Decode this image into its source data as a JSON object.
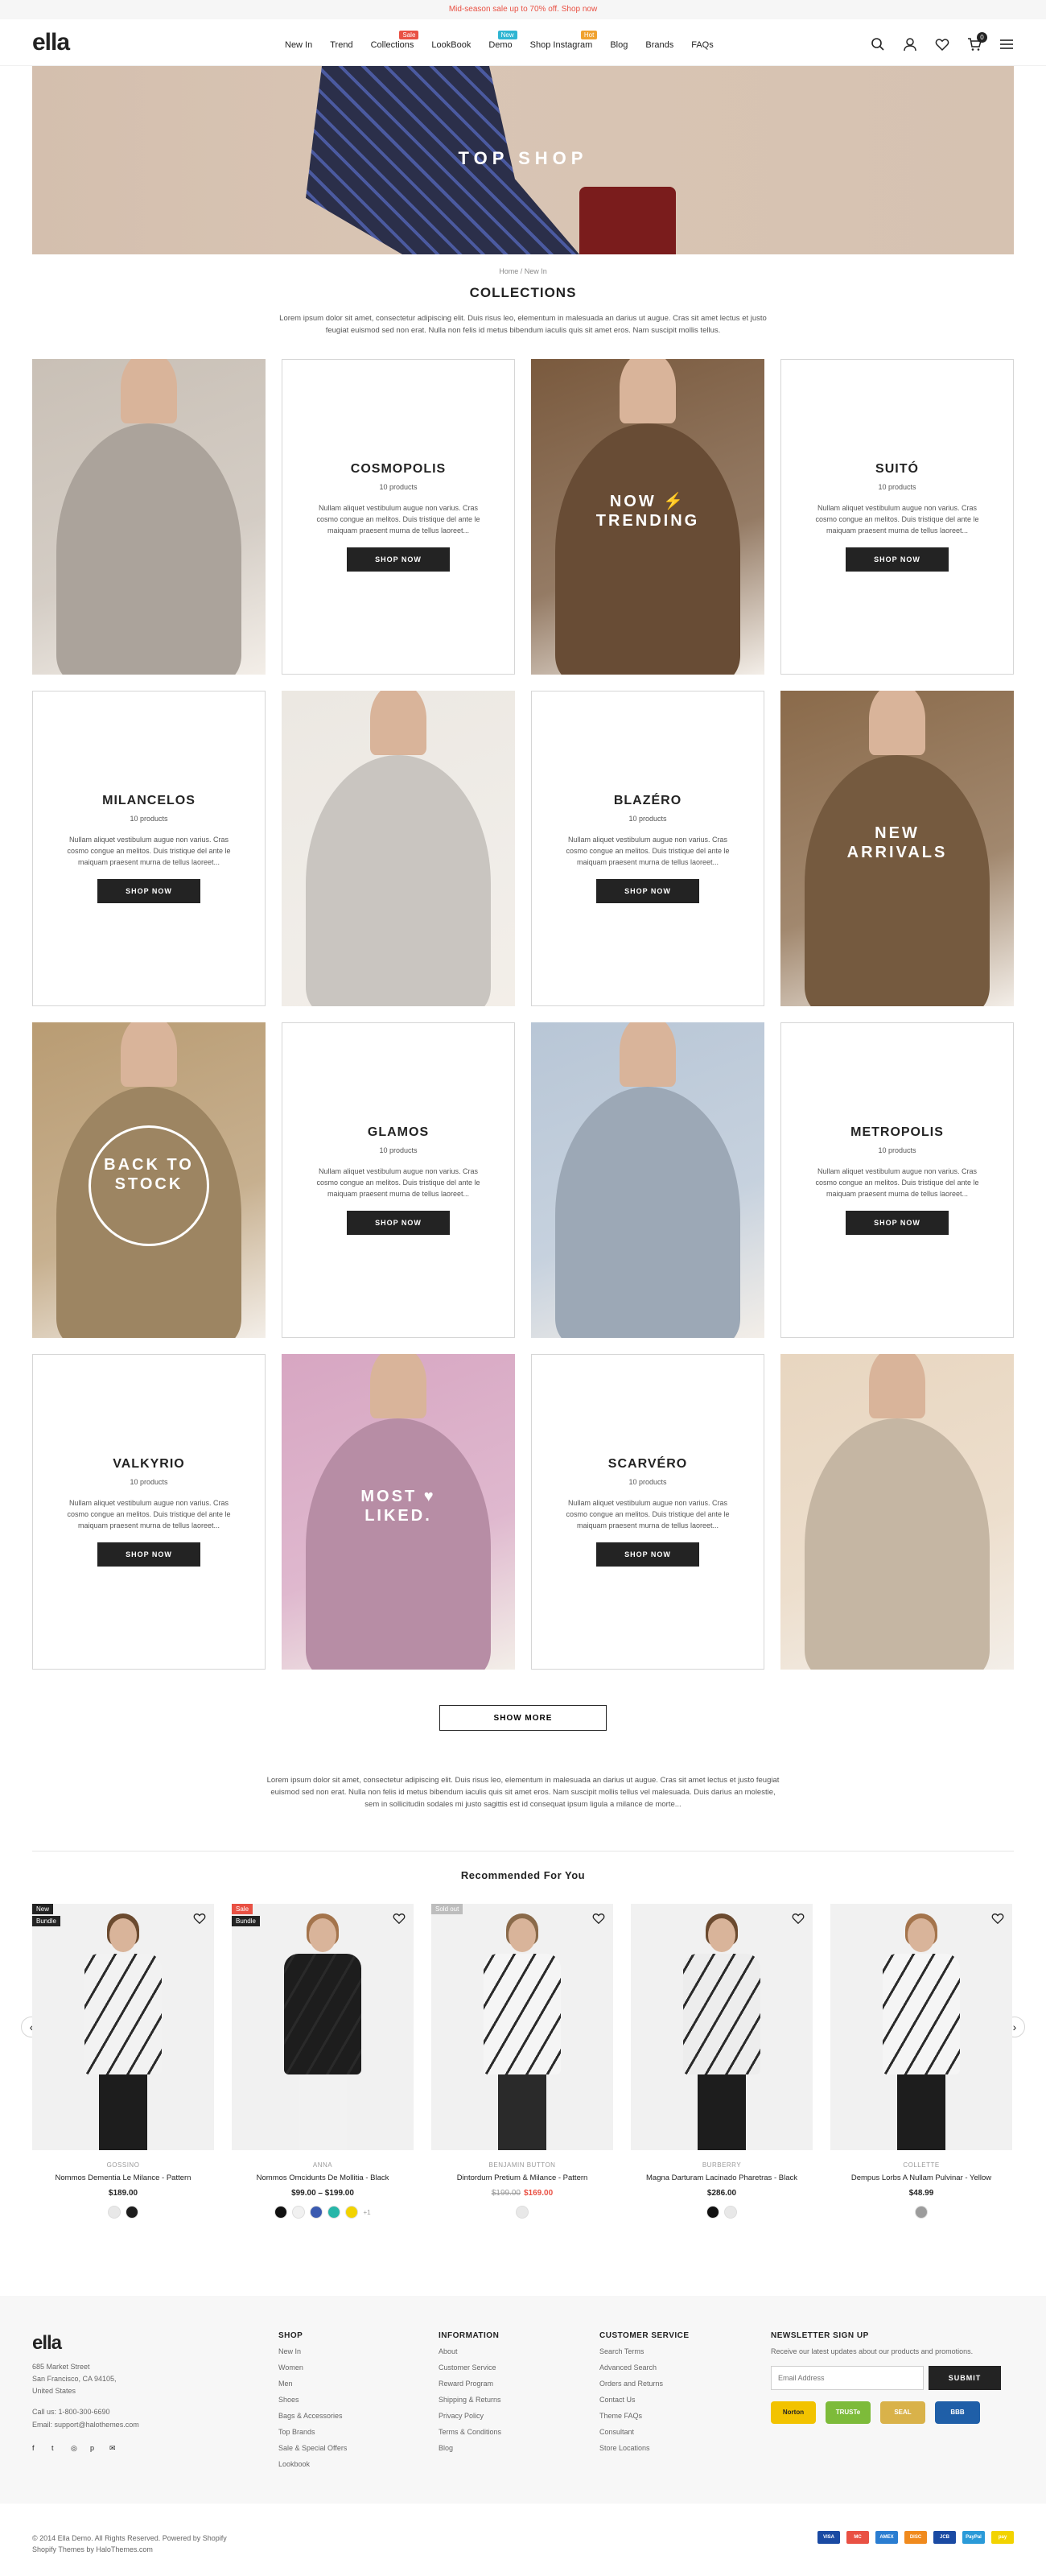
{
  "announcement": "Mid-season sale up to 70% off. Shop now",
  "logo": "ella",
  "nav": [
    {
      "label": "New In",
      "badge": "",
      "badge_color": ""
    },
    {
      "label": "Trend",
      "badge": "",
      "badge_color": ""
    },
    {
      "label": "Collections",
      "badge": "Sale",
      "badge_color": "#e95144"
    },
    {
      "label": "LookBook",
      "badge": "",
      "badge_color": ""
    },
    {
      "label": "Demo",
      "badge": "New",
      "badge_color": "#2fb5d2"
    },
    {
      "label": "Shop Instagram",
      "badge": "Hot",
      "badge_color": "#f0a230"
    },
    {
      "label": "Blog",
      "badge": "",
      "badge_color": ""
    },
    {
      "label": "Brands",
      "badge": "",
      "badge_color": ""
    },
    {
      "label": "FAQs",
      "badge": "",
      "badge_color": ""
    }
  ],
  "header_icons": [
    "search-icon",
    "account-icon",
    "wishlist-icon",
    "cart-icon",
    "menu-icon"
  ],
  "cart_count": "0",
  "hero_title": "TOP SHOP",
  "breadcrumb": {
    "home": "Home",
    "separator": "/",
    "current": "New In"
  },
  "page_title": "COLLECTIONS",
  "page_description": "Lorem ipsum dolor sit amet, consectetur adipiscing elit. Duis risus leo, elementum in malesuada an darius ut augue. Cras sit amet lectus et justo feugiat euismod sed non erat. Nulla non felis id metus bibendum iaculis quis sit amet eros. Nam suscipit mollis tellus.",
  "collections": [
    {
      "kind": "photo",
      "label": "",
      "tone": "#c9c0b6"
    },
    {
      "kind": "card",
      "title": "COSMOPOLIS",
      "count": "10 products",
      "desc": "Nullam aliquet vestibulum augue non varius. Cras cosmo congue an melitos. Duis tristique del ante le maiquam praesent murna de tellus laoreet...",
      "button": "SHOP NOW"
    },
    {
      "kind": "photo",
      "label": "NOW ⚡ TRENDING",
      "tone": "#7a5a3e"
    },
    {
      "kind": "card",
      "title": "SUITÓ",
      "count": "10 products",
      "desc": "Nullam aliquet vestibulum augue non varius. Cras cosmo congue an melitos. Duis tristique del ante le maiquam praesent murna de tellus laoreet...",
      "button": "SHOP NOW"
    },
    {
      "kind": "card",
      "title": "MILANCELOS",
      "count": "10 products",
      "desc": "Nullam aliquet vestibulum augue non varius. Cras cosmo congue an melitos. Duis tristique del ante le maiquam praesent murna de tellus laoreet...",
      "button": "SHOP NOW"
    },
    {
      "kind": "photo",
      "label": "",
      "tone": "#ece8e2"
    },
    {
      "kind": "card",
      "title": "BLAZÉRO",
      "count": "10 products",
      "desc": "Nullam aliquet vestibulum augue non varius. Cras cosmo congue an melitos. Duis tristique del ante le maiquam praesent murna de tellus laoreet...",
      "button": "SHOP NOW"
    },
    {
      "kind": "photo",
      "label": "NEW ARRIVALS",
      "tone": "#8a6a4a"
    },
    {
      "kind": "photo",
      "label": "BACK TO STOCK",
      "tone": "#b99c73"
    },
    {
      "kind": "card",
      "title": "GLAMOS",
      "count": "10 products",
      "desc": "Nullam aliquet vestibulum augue non varius. Cras cosmo congue an melitos. Duis tristique del ante le maiquam praesent murna de tellus laoreet...",
      "button": "SHOP NOW"
    },
    {
      "kind": "photo",
      "label": "",
      "tone": "#b8c6d6"
    },
    {
      "kind": "card",
      "title": "METROPOLIS",
      "count": "10 products",
      "desc": "Nullam aliquet vestibulum augue non varius. Cras cosmo congue an melitos. Duis tristique del ante le maiquam praesent murna de tellus laoreet...",
      "button": "SHOP NOW"
    },
    {
      "kind": "card",
      "title": "VALKYRIO",
      "count": "10 products",
      "desc": "Nullam aliquet vestibulum augue non varius. Cras cosmo congue an melitos. Duis tristique del ante le maiquam praesent murna de tellus laoreet...",
      "button": "SHOP NOW"
    },
    {
      "kind": "photo",
      "label": "MOST ♥ LIKED.",
      "tone": "#d7a6c2"
    },
    {
      "kind": "card",
      "title": "SCARVÉRO",
      "count": "10 products",
      "desc": "Nullam aliquet vestibulum augue non varius. Cras cosmo congue an melitos. Duis tristique del ante le maiquam praesent murna de tellus laoreet...",
      "button": "SHOP NOW"
    },
    {
      "kind": "photo",
      "label": "",
      "tone": "#e8d6c0"
    }
  ],
  "show_more": "SHOW MORE",
  "bottom_description": "Lorem ipsum dolor sit amet, consectetur adipiscing elit. Duis risus leo, elementum in malesuada an darius ut augue. Cras sit amet lectus et justo feugiat euismod sed non erat. Nulla non felis id metus bibendum iaculis quis sit amet eros. Nam suscipit mollis tellus vel malesuada. Duis darius an molestie, sem in sollicitudin sodales mi justo sagittis est id consequat ipsum ligula a milance de morte...",
  "recommended_title": "Recommended For You",
  "products": [
    {
      "badges": [
        {
          "text": "New",
          "color": "#232323"
        },
        {
          "text": "Bundle",
          "color": "#232323"
        }
      ],
      "vendor": "GOSSINO",
      "name": "Nommos Dementia Le Milance - Pattern",
      "price": "$189.00",
      "old_price": "",
      "sale_price": "",
      "swatches": [
        "#e8e8e8",
        "#1d1d1d"
      ],
      "more": "",
      "hair": "#6b4a2f",
      "top": "#f2f2f2",
      "legs": "#1d1d1d"
    },
    {
      "badges": [
        {
          "text": "Sale",
          "color": "#e95144"
        },
        {
          "text": "Bundle",
          "color": "#232323"
        }
      ],
      "vendor": "ANNA",
      "name": "Nommos Omcidunts De Mollitia - Black",
      "price": "$99.00 – $199.00",
      "old_price": "",
      "sale_price": "",
      "swatches": [
        "#111111",
        "#f1f1f1",
        "#3a5ab0",
        "#27b6a8",
        "#f2d300"
      ],
      "more": "+1",
      "hair": "#a4744c",
      "top": "#1d1d1d",
      "legs": "#f2f2f2"
    },
    {
      "badges": [
        {
          "text": "Sold out",
          "color": "#bdbdbd"
        }
      ],
      "vendor": "BENJAMIN BUTTON",
      "name": "Dintordum Pretium & Milance - Pattern",
      "price": "",
      "old_price": "$199.00",
      "sale_price": "$169.00",
      "swatches": [
        "#e8e8e8"
      ],
      "more": "",
      "hair": "#8a6a4a",
      "top": "#f5f5f5",
      "legs": "#2a2a2a"
    },
    {
      "badges": [],
      "vendor": "BURBERRY",
      "name": "Magna Darturam Lacinado Pharetras - Black",
      "price": "$286.00",
      "old_price": "",
      "sale_price": "",
      "swatches": [
        "#111111",
        "#e8e8e8"
      ],
      "more": "",
      "hair": "#6b4a2f",
      "top": "#ededed",
      "legs": "#1d1d1d"
    },
    {
      "badges": [],
      "vendor": "COLLETTE",
      "name": "Dempus Lorbs A Nullam Pulvinar - Yellow",
      "price": "$48.99",
      "old_price": "",
      "sale_price": "",
      "swatches": [
        "#9c9c9c"
      ],
      "more": "",
      "hair": "#a4744c",
      "top": "#f5f5f5",
      "legs": "#1d1d1d"
    }
  ],
  "footer": {
    "logo": "ella",
    "address": [
      "685 Market Street",
      "San Francisco, CA 94105,",
      "United States"
    ],
    "phone": "Call us: 1-800-300-6690",
    "email": "Email: support@halothemes.com",
    "social": [
      "f",
      "t",
      "◎",
      "p",
      "✉"
    ],
    "shop": {
      "title": "SHOP",
      "links": [
        "New In",
        "Women",
        "Men",
        "Shoes",
        "Bags & Accessories",
        "Top Brands",
        "Sale & Special Offers",
        "Lookbook"
      ]
    },
    "information": {
      "title": "INFORMATION",
      "links": [
        "About",
        "Customer Service",
        "Reward Program",
        "Shipping & Returns",
        "Privacy Policy",
        "Terms & Conditions",
        "Blog"
      ]
    },
    "customer_service": {
      "title": "CUSTOMER SERVICE",
      "links": [
        "Search Terms",
        "Advanced Search",
        "Orders and Returns",
        "Contact Us",
        "Theme FAQs",
        "Consultant",
        "Store Locations"
      ]
    },
    "newsletter": {
      "title": "NEWSLETTER SIGN UP",
      "text": "Receive our latest updates about our products and promotions.",
      "placeholder": "Email Address",
      "button": "SUBMIT"
    },
    "trust_badges": [
      {
        "text": "Norton",
        "bg": "#f2c300",
        "fg": "#232323"
      },
      {
        "text": "TRUSTe",
        "bg": "#7dbb3a",
        "fg": "#ffffff"
      },
      {
        "text": "SEAL",
        "bg": "#d9b24a",
        "fg": "#ffffff"
      },
      {
        "text": "BBB",
        "bg": "#1f5fa8",
        "fg": "#ffffff"
      }
    ],
    "copyright": "© 2014 Ella Demo. All Rights Reserved. Powered by Shopify",
    "credit": "Shopify Themes by HaloThemes.com",
    "payments": [
      {
        "text": "VISA",
        "bg": "#1a4aa3"
      },
      {
        "text": "MC",
        "bg": "#e95144"
      },
      {
        "text": "AMEX",
        "bg": "#2a7dd1"
      },
      {
        "text": "DISC",
        "bg": "#f08a1d"
      },
      {
        "text": "JCB",
        "bg": "#1a4aa3"
      },
      {
        "text": "PayPal",
        "bg": "#2a9ad8"
      },
      {
        "text": "pay",
        "bg": "#f2d300"
      }
    ]
  }
}
